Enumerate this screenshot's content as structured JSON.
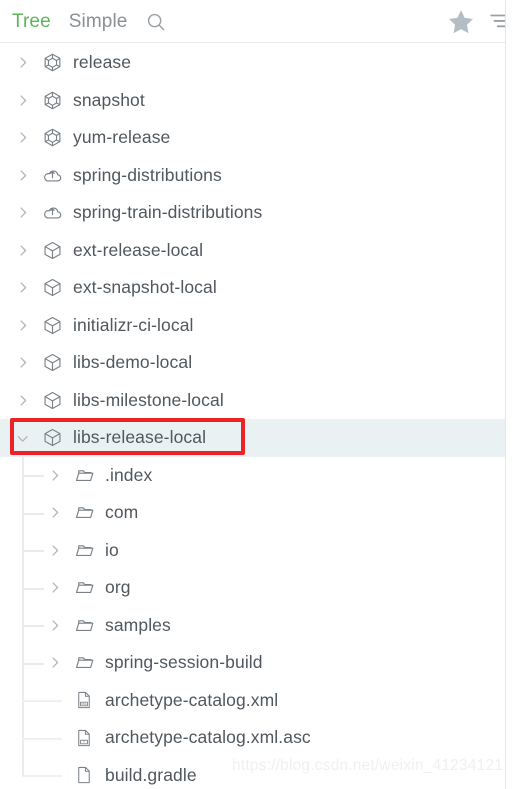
{
  "header": {
    "tabs": [
      {
        "label": "Tree",
        "active": true,
        "color": "#5bb65b"
      },
      {
        "label": "Simple",
        "active": false,
        "color": "#8b9096"
      }
    ],
    "search_icon": "search-icon",
    "star_icon": "star-icon",
    "filter_icon": "filter-icon"
  },
  "colors": {
    "accent_active_tab": "#5bb65b",
    "inactive_tab": "#8b9096",
    "selected_row_bg": "#e9f1f3",
    "annotation_red": "#ec2227",
    "label_text": "#50575e",
    "guide_line": "#ebebeb"
  },
  "tree": {
    "nodes": [
      {
        "label": "release",
        "level": 0,
        "icon": "remote-repository-icon",
        "state": "collapsed"
      },
      {
        "label": "snapshot",
        "level": 0,
        "icon": "remote-repository-icon",
        "state": "collapsed"
      },
      {
        "label": "yum-release",
        "level": 0,
        "icon": "remote-repository-icon",
        "state": "collapsed"
      },
      {
        "label": "spring-distributions",
        "level": 0,
        "icon": "distribution-repository-icon",
        "state": "collapsed"
      },
      {
        "label": "spring-train-distributions",
        "level": 0,
        "icon": "distribution-repository-icon",
        "state": "collapsed"
      },
      {
        "label": "ext-release-local",
        "level": 0,
        "icon": "local-repository-icon",
        "state": "collapsed"
      },
      {
        "label": "ext-snapshot-local",
        "level": 0,
        "icon": "local-repository-icon",
        "state": "collapsed"
      },
      {
        "label": "initializr-ci-local",
        "level": 0,
        "icon": "local-repository-icon",
        "state": "collapsed"
      },
      {
        "label": "libs-demo-local",
        "level": 0,
        "icon": "local-repository-icon",
        "state": "collapsed"
      },
      {
        "label": "libs-milestone-local",
        "level": 0,
        "icon": "local-repository-icon",
        "state": "collapsed"
      },
      {
        "label": "libs-release-local",
        "level": 0,
        "icon": "local-repository-icon",
        "state": "expanded",
        "selected": true,
        "annotated": true
      },
      {
        "label": ".index",
        "level": 1,
        "icon": "folder-icon",
        "state": "collapsed"
      },
      {
        "label": "com",
        "level": 1,
        "icon": "folder-icon",
        "state": "collapsed"
      },
      {
        "label": "io",
        "level": 1,
        "icon": "folder-icon",
        "state": "collapsed"
      },
      {
        "label": "org",
        "level": 1,
        "icon": "folder-icon",
        "state": "collapsed"
      },
      {
        "label": "samples",
        "level": 1,
        "icon": "folder-icon",
        "state": "collapsed"
      },
      {
        "label": "spring-session-build",
        "level": 1,
        "icon": "folder-icon",
        "state": "collapsed"
      },
      {
        "label": "archetype-catalog.xml",
        "level": 1,
        "icon": "xml-file-icon",
        "state": "leaf"
      },
      {
        "label": "archetype-catalog.xml.asc",
        "level": 1,
        "icon": "text-file-icon",
        "state": "leaf"
      },
      {
        "label": "build.gradle",
        "level": 1,
        "icon": "generic-file-icon",
        "state": "leaf"
      }
    ]
  },
  "watermark": {
    "text": "https://blog.csdn.net/weixin_41234121"
  }
}
